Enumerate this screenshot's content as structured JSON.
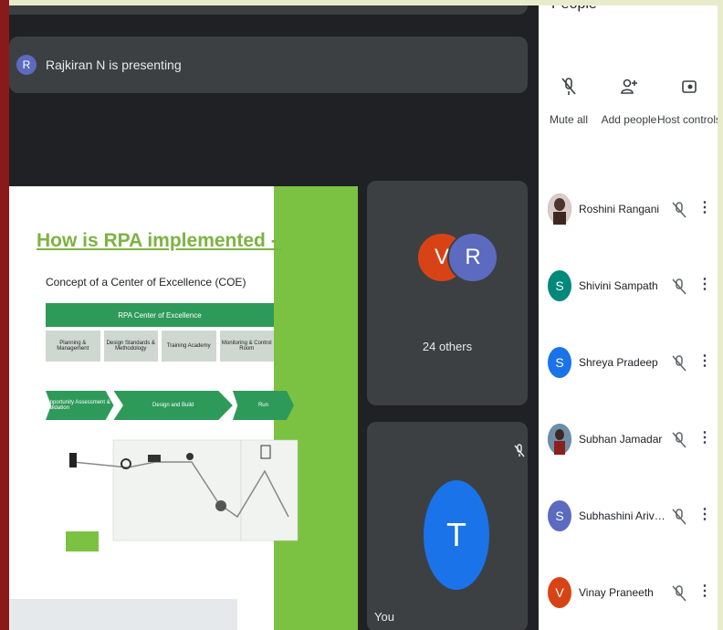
{
  "meet": {
    "presenting": {
      "initial": "R",
      "text": "Rajkiran N is presenting"
    },
    "slide": {
      "title": "How is RPA implemented - Organizational",
      "subtitle": "Concept of a Center of Excellence (COE)",
      "coe_header": "RPA Center of Excellence",
      "coe_cells": [
        "Planning & Management",
        "Design Standards & Methodology",
        "Training Academy",
        "Monitoring & Control Room"
      ],
      "phases": [
        "Opportunity Assessment & Validation",
        "Design and Build",
        "Run"
      ]
    },
    "others_tile": {
      "initials": [
        "V",
        "R"
      ],
      "label": "24 others"
    },
    "you_tile": {
      "initial": "T",
      "label": "You"
    }
  },
  "panel": {
    "title": "People",
    "actions": [
      {
        "label": "Mute all",
        "icon": "mic-off-icon"
      },
      {
        "label": "Add people",
        "icon": "add-person-icon"
      },
      {
        "label": "Host controls",
        "icon": "host-controls-icon"
      }
    ],
    "people": [
      {
        "name": "Roshini Rangani",
        "initial": "",
        "color": "#4e342e",
        "photo": true
      },
      {
        "name": "Shivini Sampath",
        "initial": "S",
        "color": "#00897b",
        "photo": false
      },
      {
        "name": "Shreya Pradeep",
        "initial": "S",
        "color": "#1a73e8",
        "photo": false
      },
      {
        "name": "Subhan Jamadar",
        "initial": "",
        "color": "#546e7a",
        "photo": true
      },
      {
        "name": "Subhashini Arivazhagan",
        "initial": "S",
        "color": "#5c6bc0",
        "photo": false
      },
      {
        "name": "Vinay Praneeth",
        "initial": "V",
        "color": "#d84315",
        "photo": false
      }
    ]
  },
  "colors": {
    "meet_bg": "#202124",
    "tile_bg": "#3c4043",
    "slide_green": "#7cc242",
    "rpa_green": "#2e9a5a"
  }
}
